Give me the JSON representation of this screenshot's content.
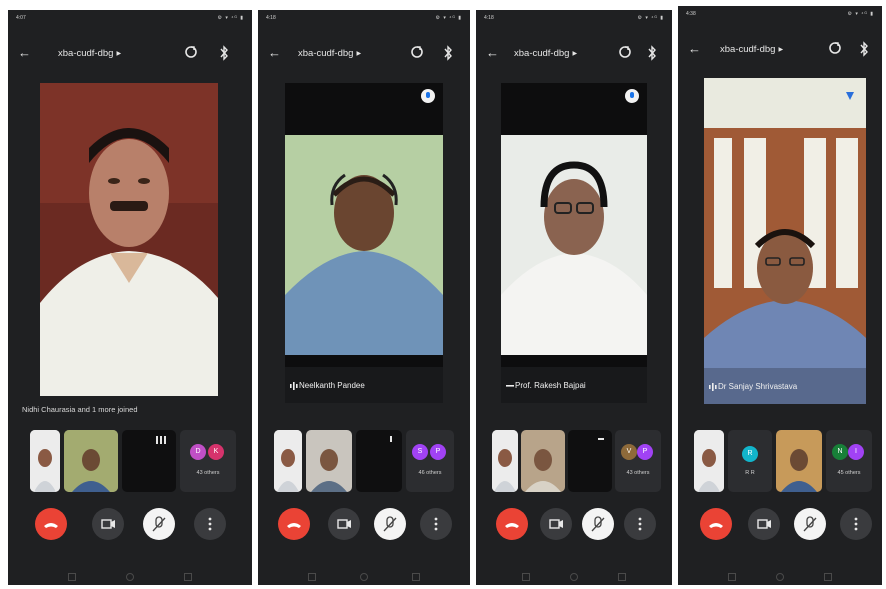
{
  "phones": [
    {
      "status_time": "4:07",
      "status_icons": "⚙ ▾ ⁴ᴳ ▮",
      "meeting_code": "xba-cudf-dbg",
      "joined_text": "Nidhi Chaurasia and 1 more joined",
      "main_video_name": "",
      "others_avatars": [
        "D",
        "K"
      ],
      "others_count": "43 others"
    },
    {
      "status_time": "4:18",
      "status_icons": "⚙ ▾ ⁴ᴳ ▮",
      "meeting_code": "xba-cudf-dbg",
      "main_video_name": "Neelkanth Pandee",
      "others_avatars": [
        "S",
        "P"
      ],
      "others_count": "46 others"
    },
    {
      "status_time": "4:18",
      "status_icons": "⚙ ▾ ⁴ᴳ ▮",
      "meeting_code": "xba-cudf-dbg",
      "main_video_name": "Prof. Rakesh Bajpai",
      "others_avatars": [
        "V",
        "P"
      ],
      "others_count": "43 others"
    },
    {
      "status_time": "4:38",
      "status_icons": "⚙ ▾ ⁴ᴳ ▮",
      "meeting_code": "xba-cudf-dbg",
      "main_video_name": "Dr Sanjay Shrivastava",
      "tile_initial_1": "R",
      "tile_name_1": "R R",
      "others_avatars": [
        "N",
        "I"
      ],
      "others_count": "45 others"
    }
  ],
  "colors": {
    "background": "#1f2022",
    "end_call": "#ea4335",
    "avatar_d": "#c04fc6",
    "avatar_k": "#d6336c",
    "avatar_s": "#a142f4",
    "avatar_p": "#a142f4",
    "avatar_v": "#8e6a3a",
    "avatar_r": "#12b5cb",
    "avatar_n": "#188038",
    "avatar_i": "#a142f4"
  }
}
